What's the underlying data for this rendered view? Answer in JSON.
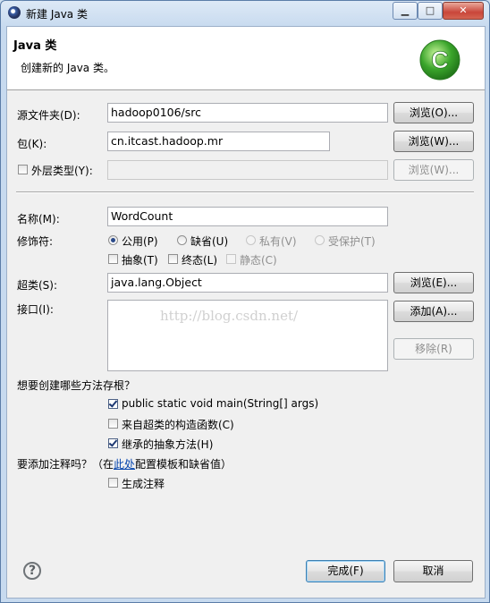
{
  "window": {
    "title": "新建 Java 类",
    "min_label": "▁",
    "max_label": "□",
    "close_label": "✕"
  },
  "banner": {
    "title": "Java 类",
    "subtitle": "创建新的 Java 类。",
    "logo_letter": "C"
  },
  "source_folder": {
    "label": "源文件夹(D):",
    "value": "hadoop0106/src",
    "browse_label": "浏览(O)..."
  },
  "package": {
    "label": "包(K):",
    "value": "cn.itcast.hadoop.mr",
    "browse_label": "浏览(W)..."
  },
  "enclosing": {
    "label": "外层类型(Y):",
    "value": "",
    "browse_label": "浏览(W)..."
  },
  "name": {
    "label": "名称(M):",
    "value": "WordCount"
  },
  "modifiers": {
    "label": "修饰符:",
    "public": "公用(P)",
    "default": "缺省(U)",
    "private": "私有(V)",
    "protected": "受保护(T)",
    "abstract": "抽象(T)",
    "final": "终态(L)",
    "static": "静态(C)"
  },
  "superclass": {
    "label": "超类(S):",
    "value": "java.lang.Object",
    "browse_label": "浏览(E)..."
  },
  "interfaces": {
    "label": "接口(I):",
    "add_label": "添加(A)...",
    "remove_label": "移除(R)",
    "watermark": "http://blog.csdn.net/"
  },
  "stubs": {
    "question": "想要创建哪些方法存根？",
    "main": "public static void main(String[] args)",
    "constructors": "来自超类的构造函数(C)",
    "inherited": "继承的抽象方法(H)"
  },
  "comments": {
    "q_prefix": "要添加注释吗？（在",
    "q_link": "此处",
    "q_suffix": "配置模板和缺省值）",
    "generate": "生成注释"
  },
  "footer": {
    "help_label": "?",
    "finish_label": "完成(F)",
    "cancel_label": "取消"
  },
  "colors": {
    "logo_green": "#3aa52b",
    "link": "#0645ad",
    "accent": "#3c7fb1"
  }
}
